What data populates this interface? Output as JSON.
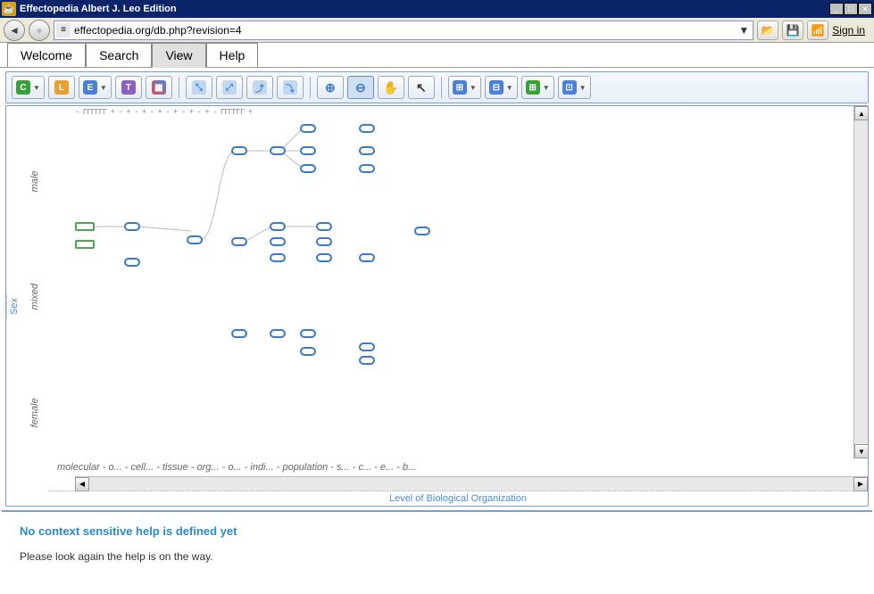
{
  "titlebar": {
    "title": "Effectopedia  Albert J. Leo Edition"
  },
  "addrbar": {
    "url": "effectopedia.org/db.php?revision=4",
    "signin": "Sign in"
  },
  "tabs": [
    {
      "label": "Welcome"
    },
    {
      "label": "Search"
    },
    {
      "label": "View"
    },
    {
      "label": "Help"
    }
  ],
  "yaxis": {
    "label": "Sex",
    "ticks": [
      "male",
      "mixed",
      "female"
    ]
  },
  "xaxis": {
    "label": "Level of Biological Organization",
    "ticks": "molecular  -  o...  -  cell...  -  tissue  -  org...  -  o...  -  indi...  -   population   -  s...  -  c...  -  e...  -  b..."
  },
  "help": {
    "title": "No context sensitive help is defined yet",
    "text": "Please look again the help is on the way."
  },
  "ruler": "- ГГГГГГ +            - +  - +     - +  - + - +   - +      - ГГГГГГ +"
}
